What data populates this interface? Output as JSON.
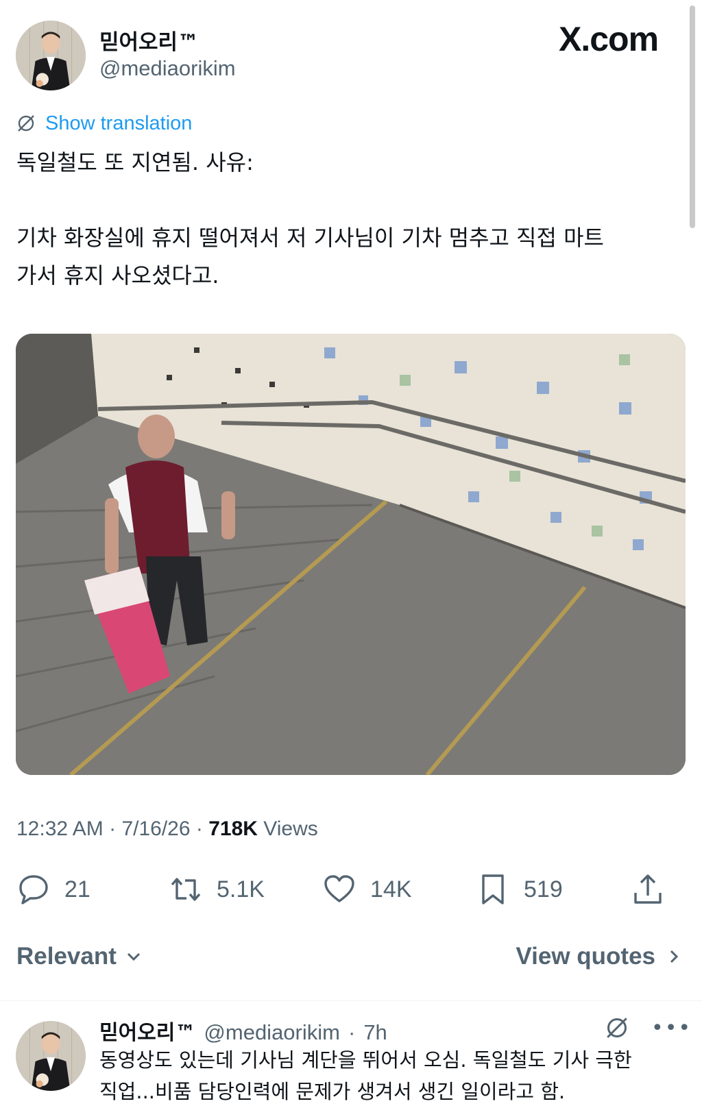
{
  "header": {
    "display_name": "믿어오리™",
    "handle": "@mediaorikim",
    "brand": "X.com"
  },
  "translation": {
    "label": "Show translation",
    "icon": "globe-slash-icon"
  },
  "tweet": {
    "text": "독일철도 또 지연됨. 사유:\n\n기차 화장실에 휴지 떨어져서 저 기사님이 기차 멈추고 직접 마트\n가서 휴지 사오셨다고."
  },
  "meta": {
    "time": "12:32 AM",
    "date": "7/16/26",
    "views_count": "718K",
    "views_label": "Views"
  },
  "actions": {
    "replies": "21",
    "reposts": "5.1K",
    "likes": "14K",
    "bookmarks": "519"
  },
  "sort": {
    "label": "Relevant",
    "view_quotes": "View quotes"
  },
  "reply": {
    "display_name": "믿어오리™",
    "handle": "@mediaorikim",
    "time": "7h",
    "text": "동영상도 있는데 기사님 계단을 뛰어서 오심. 독일철도 기사 극한\n직업...비품 담당인력에 문제가 생겨서 생긴 일이라고 함."
  },
  "colors": {
    "accent": "#1d9bf0",
    "text_primary": "#0f1419",
    "text_secondary": "#536471"
  }
}
